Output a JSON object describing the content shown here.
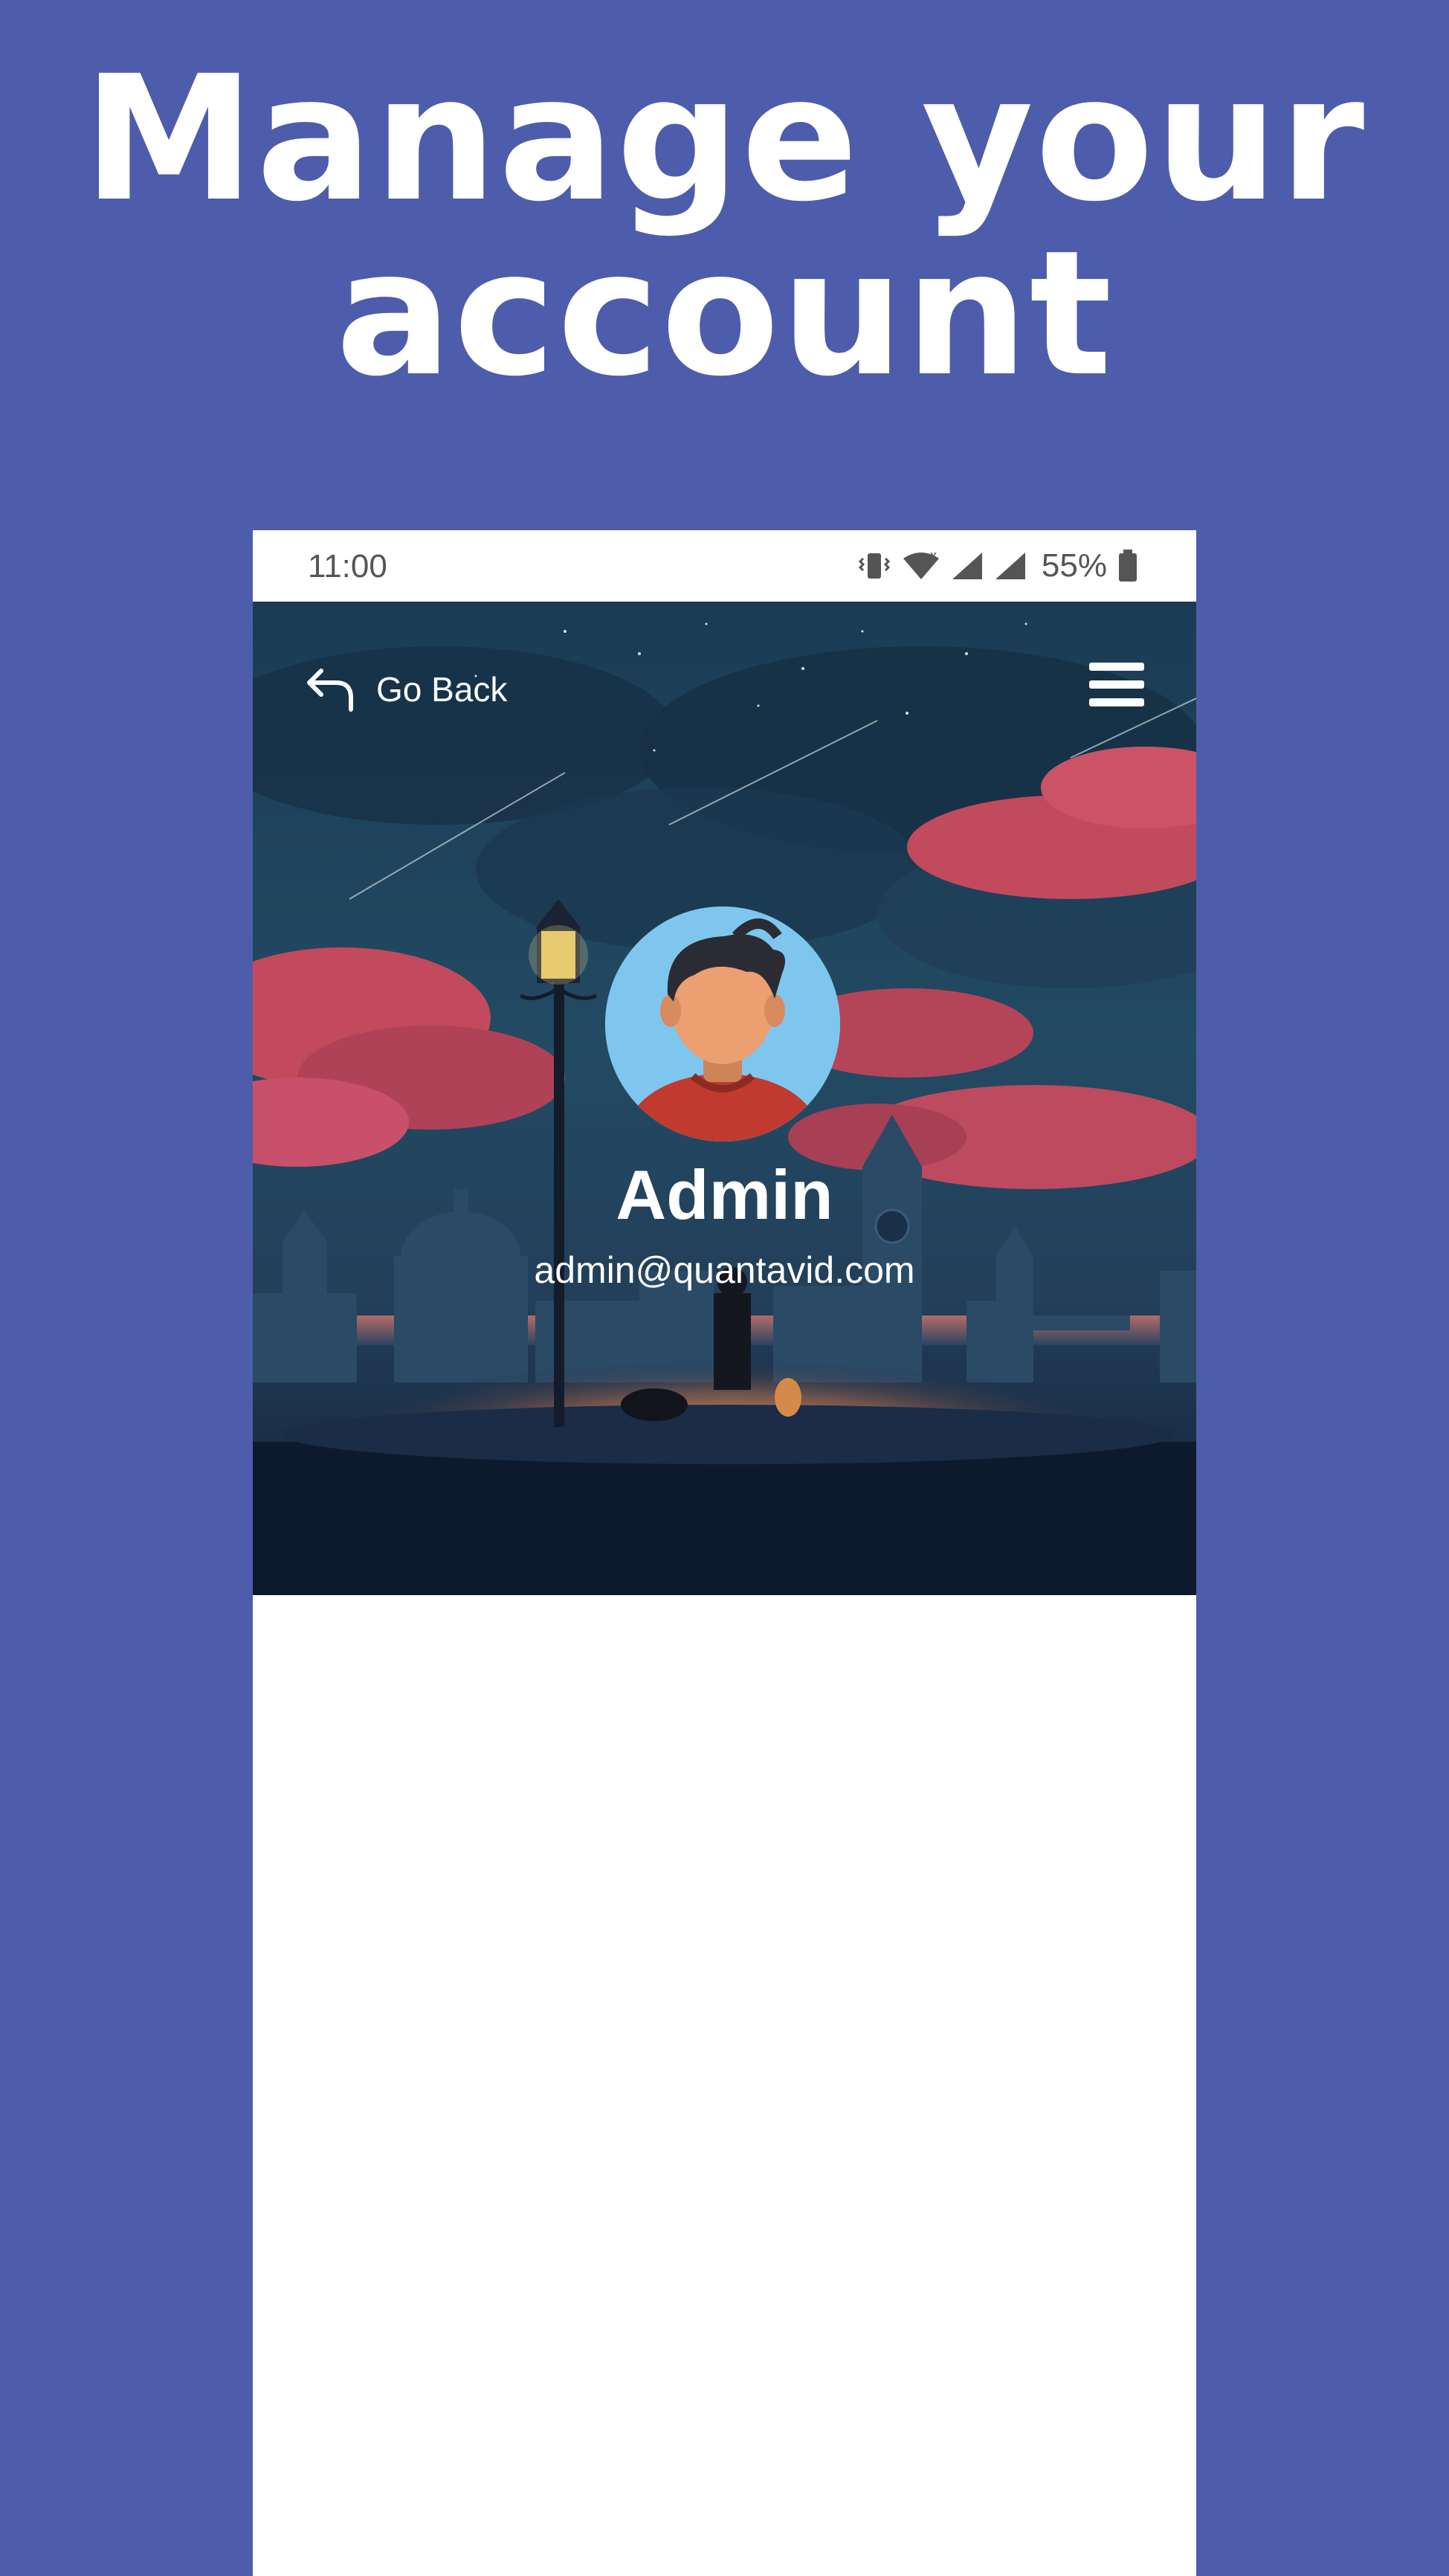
{
  "promo": {
    "title_line1": "Manage your",
    "title_line2": "account"
  },
  "status_bar": {
    "time": "11:00",
    "battery": "55%",
    "icons": [
      "vibrate-icon",
      "wifi-icon",
      "signal-icon",
      "signal-icon",
      "battery-icon"
    ]
  },
  "header": {
    "back_label": "Go Back",
    "back_icon": "undo-arrow-icon",
    "menu_icon": "hamburger-menu-icon"
  },
  "profile": {
    "name": "Admin",
    "email": "admin@quantavid.com",
    "avatar_icon": "user-avatar-icon"
  },
  "colors": {
    "background": "#4d5dab",
    "phone_bg": "#ffffff",
    "sky": "#1b3a55",
    "clouds": "#c5485a"
  }
}
